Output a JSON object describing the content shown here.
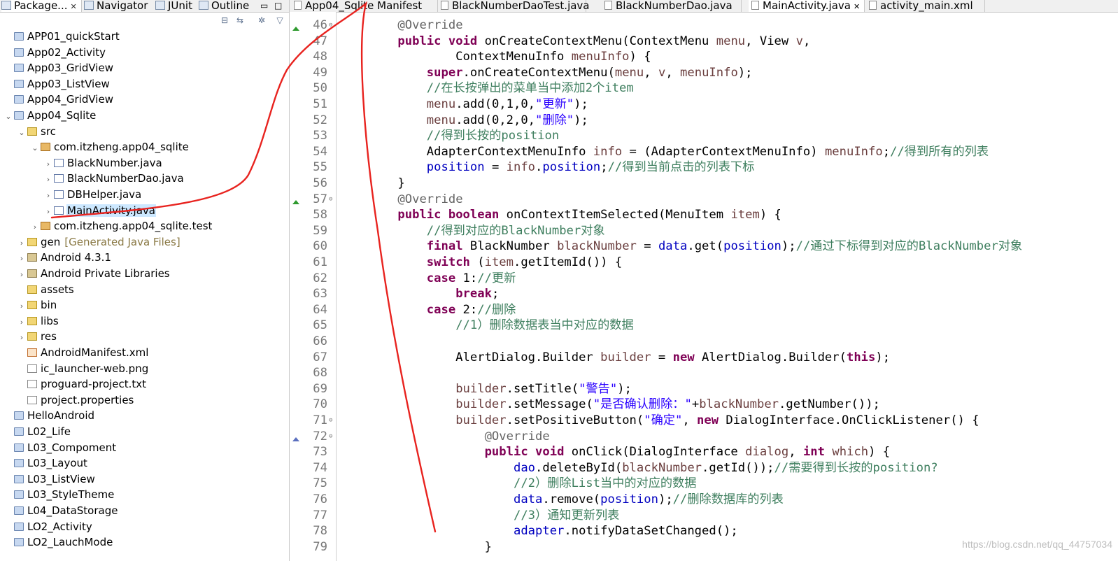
{
  "left_panel": {
    "tabs": [
      {
        "label": "Package...",
        "closable": true
      },
      {
        "label": "Navigator"
      },
      {
        "label": "JUnit"
      },
      {
        "label": "Outline"
      }
    ],
    "tree": [
      {
        "label": "APP01_quickStart",
        "icon": "project",
        "depth": 0,
        "arrow": ""
      },
      {
        "label": "App02_Activity",
        "icon": "project",
        "depth": 0,
        "arrow": ""
      },
      {
        "label": "App03_GridView",
        "icon": "project",
        "depth": 0,
        "arrow": ""
      },
      {
        "label": "App03_ListView",
        "icon": "project",
        "depth": 0,
        "arrow": ""
      },
      {
        "label": "App04_GridView",
        "icon": "project",
        "depth": 0,
        "arrow": ""
      },
      {
        "label": "App04_Sqlite",
        "icon": "project",
        "depth": 0,
        "arrow": "v"
      },
      {
        "label": "src",
        "icon": "folder",
        "depth": 1,
        "arrow": "v"
      },
      {
        "label": "com.itzheng.app04_sqlite",
        "icon": "package",
        "depth": 2,
        "arrow": "v"
      },
      {
        "label": "BlackNumber.java",
        "icon": "java",
        "depth": 3,
        "arrow": ">"
      },
      {
        "label": "BlackNumberDao.java",
        "icon": "java",
        "depth": 3,
        "arrow": ">"
      },
      {
        "label": "DBHelper.java",
        "icon": "java",
        "depth": 3,
        "arrow": ">"
      },
      {
        "label": "MainActivity.java",
        "icon": "java",
        "depth": 3,
        "arrow": ">",
        "selected": true
      },
      {
        "label": "com.itzheng.app04_sqlite.test",
        "icon": "package",
        "depth": 2,
        "arrow": ">"
      },
      {
        "label": "gen",
        "suffix": "[Generated Java Files]",
        "icon": "folder",
        "depth": 1,
        "arrow": ">"
      },
      {
        "label": "Android 4.3.1",
        "icon": "library",
        "depth": 1,
        "arrow": ">"
      },
      {
        "label": "Android Private Libraries",
        "icon": "library",
        "depth": 1,
        "arrow": ">"
      },
      {
        "label": "assets",
        "icon": "folder",
        "depth": 1,
        "arrow": ""
      },
      {
        "label": "bin",
        "icon": "folder",
        "depth": 1,
        "arrow": ">"
      },
      {
        "label": "libs",
        "icon": "folder",
        "depth": 1,
        "arrow": ">"
      },
      {
        "label": "res",
        "icon": "folder",
        "depth": 1,
        "arrow": ">"
      },
      {
        "label": "AndroidManifest.xml",
        "icon": "xml",
        "depth": 1,
        "arrow": ""
      },
      {
        "label": "ic_launcher-web.png",
        "icon": "file",
        "depth": 1,
        "arrow": ""
      },
      {
        "label": "proguard-project.txt",
        "icon": "file",
        "depth": 1,
        "arrow": ""
      },
      {
        "label": "project.properties",
        "icon": "file",
        "depth": 1,
        "arrow": ""
      },
      {
        "label": "HelloAndroid",
        "icon": "project",
        "depth": 0,
        "arrow": ""
      },
      {
        "label": "L02_Life",
        "icon": "project",
        "depth": 0,
        "arrow": ""
      },
      {
        "label": "L03_Compoment",
        "icon": "project",
        "depth": 0,
        "arrow": ""
      },
      {
        "label": "L03_Layout",
        "icon": "project",
        "depth": 0,
        "arrow": ""
      },
      {
        "label": "L03_ListView",
        "icon": "project",
        "depth": 0,
        "arrow": ""
      },
      {
        "label": "L03_StyleTheme",
        "icon": "project",
        "depth": 0,
        "arrow": ""
      },
      {
        "label": "L04_DataStorage",
        "icon": "project",
        "depth": 0,
        "arrow": ""
      },
      {
        "label": "LO2_Activity",
        "icon": "project",
        "depth": 0,
        "arrow": ""
      },
      {
        "label": "LO2_LauchMode",
        "icon": "project",
        "depth": 0,
        "arrow": ""
      }
    ]
  },
  "editor": {
    "tabs": [
      {
        "label": "App04_Sqlite Manifest"
      },
      {
        "label": "BlackNumberDaoTest.java"
      },
      {
        "label": "BlackNumberDao.java"
      },
      {
        "label": "MainActivity.java",
        "active": true,
        "closable": true
      },
      {
        "label": "activity_main.xml"
      }
    ],
    "lines": [
      {
        "n": "46",
        "fold": true,
        "t": [
          [
            "    ",
            ""
          ],
          [
            "@Override",
            "an"
          ]
        ]
      },
      {
        "n": "47",
        "marker": "up",
        "t": [
          [
            "    ",
            ""
          ],
          [
            "public",
            "kw"
          ],
          [
            " ",
            ""
          ],
          [
            "void",
            "kw"
          ],
          [
            " onCreateContextMenu(ContextMenu ",
            ""
          ],
          [
            "menu",
            "lv"
          ],
          [
            ", View ",
            ""
          ],
          [
            "v",
            "lv"
          ],
          [
            ",",
            ""
          ]
        ]
      },
      {
        "n": "48",
        "t": [
          [
            "            ContextMenuInfo ",
            ""
          ],
          [
            "menuInfo",
            "lv"
          ],
          [
            ") {",
            ""
          ]
        ]
      },
      {
        "n": "49",
        "t": [
          [
            "        ",
            ""
          ],
          [
            "super",
            "kw"
          ],
          [
            ".onCreateContextMenu(",
            ""
          ],
          [
            "menu",
            "lv"
          ],
          [
            ", ",
            ""
          ],
          [
            "v",
            "lv"
          ],
          [
            ", ",
            ""
          ],
          [
            "menuInfo",
            "lv"
          ],
          [
            ");",
            ""
          ]
        ]
      },
      {
        "n": "50",
        "t": [
          [
            "        ",
            ""
          ],
          [
            "//在长按弹出的菜单当中添加2个item",
            "cm"
          ]
        ]
      },
      {
        "n": "51",
        "t": [
          [
            "        ",
            ""
          ],
          [
            "menu",
            "lv"
          ],
          [
            ".add(0,1,0,",
            ""
          ],
          [
            "\"更新\"",
            "st"
          ],
          [
            ");",
            ""
          ]
        ]
      },
      {
        "n": "52",
        "t": [
          [
            "        ",
            ""
          ],
          [
            "menu",
            "lv"
          ],
          [
            ".add(0,2,0,",
            ""
          ],
          [
            "\"删除\"",
            "st"
          ],
          [
            ");",
            ""
          ]
        ]
      },
      {
        "n": "53",
        "t": [
          [
            "        ",
            ""
          ],
          [
            "//得到长按的position",
            "cm"
          ]
        ]
      },
      {
        "n": "54",
        "t": [
          [
            "        AdapterContextMenuInfo ",
            ""
          ],
          [
            "info",
            "lv"
          ],
          [
            " = (AdapterContextMenuInfo) ",
            ""
          ],
          [
            "menuInfo",
            "lv"
          ],
          [
            ";",
            ""
          ],
          [
            "//得到所有的列表",
            "cm"
          ]
        ]
      },
      {
        "n": "55",
        "t": [
          [
            "        ",
            ""
          ],
          [
            "position",
            "fd"
          ],
          [
            " = ",
            ""
          ],
          [
            "info",
            "lv"
          ],
          [
            ".",
            ""
          ],
          [
            "position",
            "fd"
          ],
          [
            ";",
            ""
          ],
          [
            "//得到当前点击的列表下标",
            "cm"
          ]
        ]
      },
      {
        "n": "56",
        "t": [
          [
            "    }",
            ""
          ]
        ]
      },
      {
        "n": "57",
        "fold": true,
        "t": [
          [
            "    ",
            ""
          ],
          [
            "@Override",
            "an"
          ]
        ]
      },
      {
        "n": "58",
        "marker": "up",
        "t": [
          [
            "    ",
            ""
          ],
          [
            "public",
            "kw"
          ],
          [
            " ",
            ""
          ],
          [
            "boolean",
            "kw"
          ],
          [
            " onContextItemSelected(MenuItem ",
            ""
          ],
          [
            "item",
            "lv"
          ],
          [
            ") {",
            ""
          ]
        ]
      },
      {
        "n": "59",
        "t": [
          [
            "        ",
            ""
          ],
          [
            "//得到对应的BlackNumber对象",
            "cm"
          ]
        ]
      },
      {
        "n": "60",
        "t": [
          [
            "        ",
            ""
          ],
          [
            "final",
            "kw"
          ],
          [
            " BlackNumber ",
            ""
          ],
          [
            "blackNumber",
            "lv"
          ],
          [
            " = ",
            ""
          ],
          [
            "data",
            "fd"
          ],
          [
            ".get(",
            ""
          ],
          [
            "position",
            "fd"
          ],
          [
            ");",
            ""
          ],
          [
            "//通过下标得到对应的BlackNumber对象",
            "cm"
          ]
        ]
      },
      {
        "n": "61",
        "t": [
          [
            "        ",
            ""
          ],
          [
            "switch",
            "kw"
          ],
          [
            " (",
            ""
          ],
          [
            "item",
            "lv"
          ],
          [
            ".getItemId()) {",
            ""
          ]
        ]
      },
      {
        "n": "62",
        "t": [
          [
            "        ",
            ""
          ],
          [
            "case",
            "kw"
          ],
          [
            " 1:",
            ""
          ],
          [
            "//更新",
            "cm"
          ]
        ]
      },
      {
        "n": "63",
        "t": [
          [
            "            ",
            ""
          ],
          [
            "break",
            "kw"
          ],
          [
            ";",
            ""
          ]
        ]
      },
      {
        "n": "64",
        "t": [
          [
            "        ",
            ""
          ],
          [
            "case",
            "kw"
          ],
          [
            " 2:",
            ""
          ],
          [
            "//删除",
            "cm"
          ]
        ]
      },
      {
        "n": "65",
        "t": [
          [
            "            ",
            ""
          ],
          [
            "//1）删除数据表当中对应的数据",
            "cm"
          ]
        ]
      },
      {
        "n": "66",
        "t": [
          [
            "",
            ""
          ]
        ]
      },
      {
        "n": "67",
        "t": [
          [
            "            AlertDialog.Builder ",
            ""
          ],
          [
            "builder",
            "lv"
          ],
          [
            " = ",
            ""
          ],
          [
            "new",
            "kw"
          ],
          [
            " AlertDialog.Builder(",
            ""
          ],
          [
            "this",
            "kw"
          ],
          [
            ");",
            ""
          ]
        ]
      },
      {
        "n": "68",
        "t": [
          [
            "",
            ""
          ]
        ]
      },
      {
        "n": "69",
        "t": [
          [
            "            ",
            ""
          ],
          [
            "builder",
            "lv"
          ],
          [
            ".setTitle(",
            ""
          ],
          [
            "\"警告\"",
            "st"
          ],
          [
            ");",
            ""
          ]
        ]
      },
      {
        "n": "70",
        "t": [
          [
            "            ",
            ""
          ],
          [
            "builder",
            "lv"
          ],
          [
            ".setMessage(",
            ""
          ],
          [
            "\"是否确认删除：\"",
            "st"
          ],
          [
            "+",
            ""
          ],
          [
            "blackNumber",
            "lv"
          ],
          [
            ".getNumber());",
            ""
          ]
        ]
      },
      {
        "n": "71",
        "fold": true,
        "t": [
          [
            "            ",
            ""
          ],
          [
            "builder",
            "lv"
          ],
          [
            ".setPositiveButton(",
            ""
          ],
          [
            "\"确定\"",
            "st"
          ],
          [
            ", ",
            ""
          ],
          [
            "new",
            "kw"
          ],
          [
            " DialogInterface.OnClickListener() {",
            ""
          ]
        ]
      },
      {
        "n": "72",
        "fold": true,
        "t": [
          [
            "                ",
            ""
          ],
          [
            "@Override",
            "an"
          ]
        ]
      },
      {
        "n": "73",
        "marker": "ov",
        "t": [
          [
            "                ",
            ""
          ],
          [
            "public",
            "kw"
          ],
          [
            " ",
            ""
          ],
          [
            "void",
            "kw"
          ],
          [
            " onClick(DialogInterface ",
            ""
          ],
          [
            "dialog",
            "lv"
          ],
          [
            ", ",
            ""
          ],
          [
            "int",
            "kw"
          ],
          [
            " ",
            ""
          ],
          [
            "which",
            "lv"
          ],
          [
            ") {",
            ""
          ]
        ]
      },
      {
        "n": "74",
        "t": [
          [
            "                    ",
            ""
          ],
          [
            "dao",
            "fd"
          ],
          [
            ".deleteById(",
            ""
          ],
          [
            "blackNumber",
            "lv"
          ],
          [
            ".getId());",
            ""
          ],
          [
            "//需要得到长按的position?",
            "cm"
          ]
        ]
      },
      {
        "n": "75",
        "t": [
          [
            "                    ",
            ""
          ],
          [
            "//2）删除List当中的对应的数据",
            "cm"
          ]
        ]
      },
      {
        "n": "76",
        "t": [
          [
            "                    ",
            ""
          ],
          [
            "data",
            "fd"
          ],
          [
            ".remove(",
            ""
          ],
          [
            "position",
            "fd"
          ],
          [
            ");",
            ""
          ],
          [
            "//删除数据库的列表",
            "cm"
          ]
        ]
      },
      {
        "n": "77",
        "t": [
          [
            "                    ",
            ""
          ],
          [
            "//3）通知更新列表",
            "cm"
          ]
        ]
      },
      {
        "n": "78",
        "t": [
          [
            "                    ",
            ""
          ],
          [
            "adapter",
            "fd"
          ],
          [
            ".notifyDataSetChanged();",
            ""
          ]
        ]
      },
      {
        "n": "79",
        "t": [
          [
            "                }",
            ""
          ]
        ]
      }
    ]
  },
  "watermark": "https://blog.csdn.net/qq_44757034",
  "colors": {
    "keyword": "#7f0055",
    "annotation": "#646464",
    "comment": "#3f7f5f",
    "string": "#2a00ff",
    "field": "#0000c0",
    "local_variable": "#6a3e3e",
    "selection": "#cce8ff",
    "hand_annotation": "#e8231f"
  }
}
